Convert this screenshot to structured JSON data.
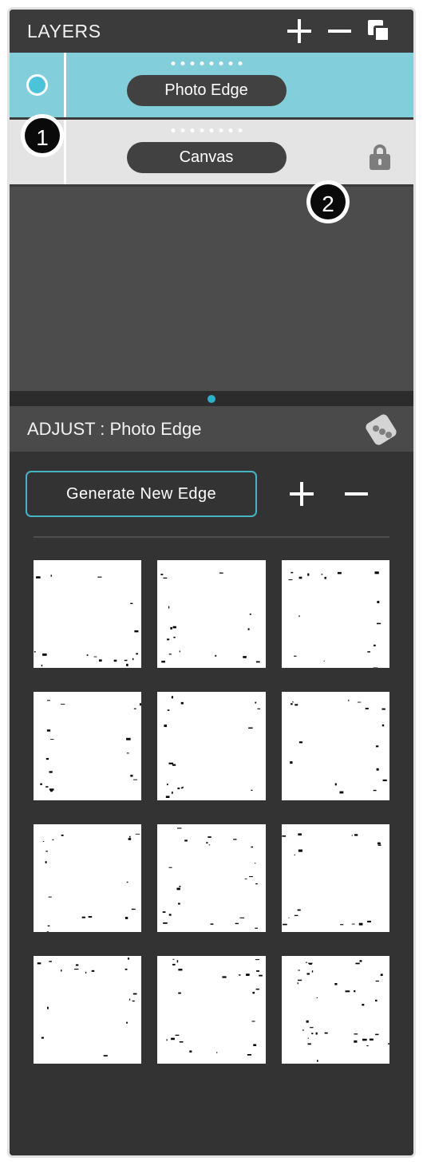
{
  "panel": {
    "layers_header": {
      "title": "LAYERS",
      "add_label": "+",
      "remove_label": "−",
      "duplicate_label": "duplicate-layer"
    },
    "layers": [
      {
        "name": "Photo Edge",
        "selected": true,
        "visible": true,
        "locked": false,
        "row_color": "#82cfdb"
      },
      {
        "name": "Canvas",
        "selected": false,
        "visible": false,
        "locked": true,
        "row_color": "#e4e4e4"
      }
    ],
    "page_indicator": {
      "pages": 1,
      "active": 1,
      "color": "#2fb0c8"
    },
    "adjust": {
      "title": "ADJUST : Photo Edge",
      "options_icon": "dice-options-icon",
      "generate_button": "Generate New Edge",
      "increase_label": "+",
      "decrease_label": "−",
      "thumbnails": [
        {
          "id": 1,
          "style": "thin-grunge"
        },
        {
          "id": 2,
          "style": "thin-grunge"
        },
        {
          "id": 3,
          "style": "thin-grunge"
        },
        {
          "id": 4,
          "style": "thin-grunge"
        },
        {
          "id": 5,
          "style": "thin-grunge"
        },
        {
          "id": 6,
          "style": "thin-grunge"
        },
        {
          "id": 7,
          "style": "thin-grunge"
        },
        {
          "id": 8,
          "style": "medium-grunge"
        },
        {
          "id": 9,
          "style": "thin-grunge"
        },
        {
          "id": 10,
          "style": "thin-grunge"
        },
        {
          "id": 11,
          "style": "medium-grunge"
        },
        {
          "id": 12,
          "style": "heavy-grunge"
        }
      ]
    },
    "callouts": [
      {
        "number": "1",
        "target": "layer-visibility-column"
      },
      {
        "number": "2",
        "target": "layer-lock-icon"
      }
    ],
    "colors": {
      "accent_teal": "#47b4c4",
      "selected_row": "#82cfdb",
      "locked_row": "#e4e4e4",
      "panel_bg": "#333333",
      "header_bg": "#3b3b3b",
      "list_bg": "#4c4c4c"
    }
  }
}
